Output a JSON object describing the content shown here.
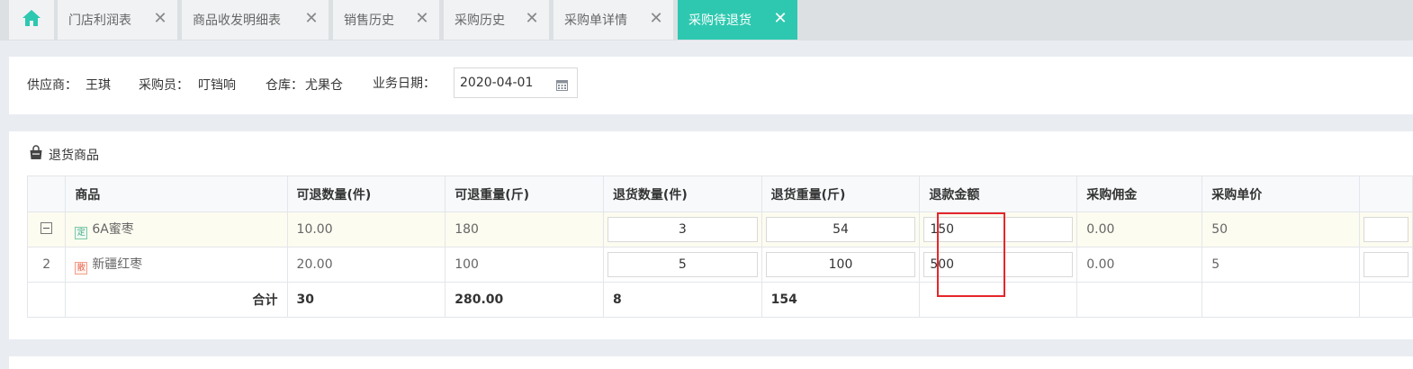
{
  "tabs": [
    {
      "label": "门店利润表"
    },
    {
      "label": "商品收发明细表"
    },
    {
      "label": "销售历史"
    },
    {
      "label": "采购历史"
    },
    {
      "label": "采购单详情"
    },
    {
      "label": "采购待退货"
    }
  ],
  "close_glyph": "✕",
  "header": {
    "supplier_label": "供应商：",
    "supplier": "王琪",
    "buyer_label": "采购员：",
    "buyer": "叮铛响",
    "warehouse_label": "仓库：",
    "warehouse": "尤果仓",
    "date_label": "业务日期：",
    "date": "2020-04-01"
  },
  "section_title": "退货商品",
  "table": {
    "columns": [
      "商品",
      "可退数量(件)",
      "可退重量(斤)",
      "退货数量(件)",
      "退货重量(斤)",
      "退款金额",
      "采购佣金",
      "采购单价"
    ],
    "rows": [
      {
        "index": "",
        "tag": "定",
        "name": "6A蜜枣",
        "avail_qty": "10.00",
        "avail_weight": "180",
        "return_qty": "3",
        "return_weight": "54",
        "refund": "150",
        "commission": "0.00",
        "unit_price": "50"
      },
      {
        "index": "2",
        "tag": "散",
        "name": "新疆红枣",
        "avail_qty": "20.00",
        "avail_weight": "100",
        "return_qty": "5",
        "return_weight": "100",
        "refund": "500",
        "commission": "0.00",
        "unit_price": "5"
      }
    ],
    "summary": {
      "label": "合计",
      "avail_qty": "30",
      "avail_weight": "280.00",
      "return_qty": "8",
      "return_weight": "154"
    }
  },
  "colors": {
    "active_tab": "#2ec8b0",
    "highlight_box": "#e5262b",
    "home_icon": "#2ec8b0"
  }
}
